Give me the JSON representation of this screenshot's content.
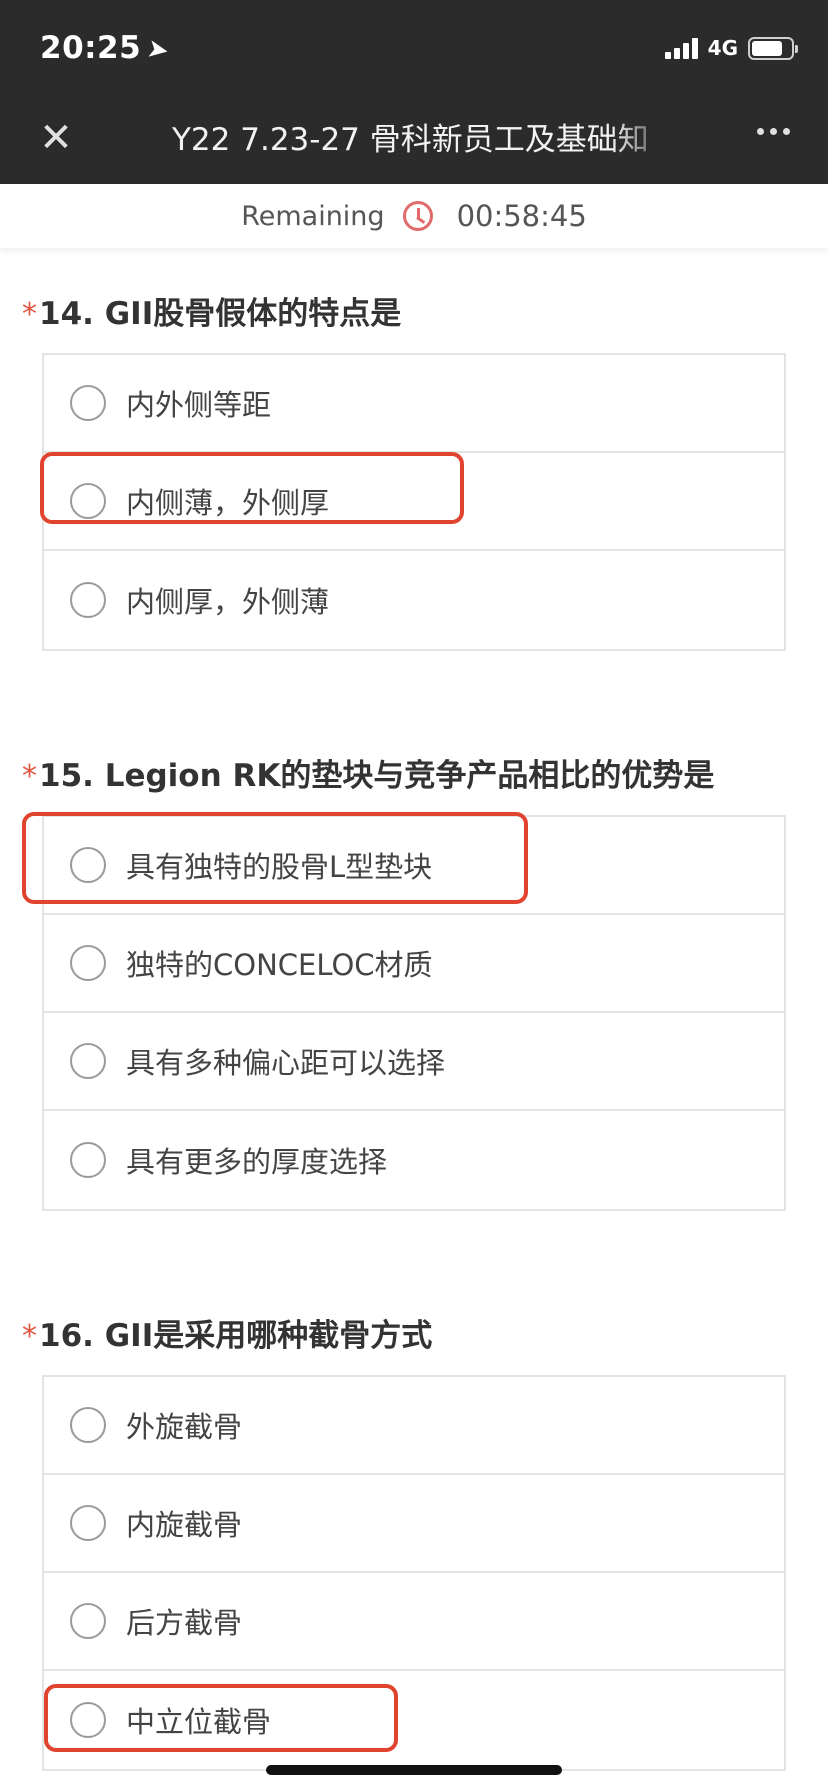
{
  "status_bar": {
    "time": "20:25",
    "network": "4G"
  },
  "nav": {
    "close_icon": "close-icon",
    "title": "Y22 7.23-27 骨科新员工及基础知",
    "more_icon": "more-icon"
  },
  "timer": {
    "label": "Remaining",
    "value": "00:58:45",
    "icon": "clock-icon",
    "icon_color": "#e06b6b"
  },
  "questions": [
    {
      "required_mark": "*",
      "title": "14. GII股骨假体的特点是",
      "options": [
        "内外侧等距",
        "内侧薄，外侧厚",
        "内侧厚，外侧薄"
      ],
      "highlighted_option": 1
    },
    {
      "required_mark": "*",
      "title": "15. Legion RK的垫块与竞争产品相比的优势是",
      "options": [
        "具有独特的股骨L型垫块",
        "独特的CONCELOC材质",
        "具有多种偏心距可以选择",
        "具有更多的厚度选择"
      ],
      "highlighted_option": 0
    },
    {
      "required_mark": "*",
      "title": "16.  GII是采用哪种截骨方式",
      "options": [
        "外旋截骨",
        "内旋截骨",
        "后方截骨",
        "中立位截骨"
      ],
      "highlighted_option": 3
    }
  ],
  "colors": {
    "header_bg": "#2b2b2b",
    "required_star": "#e0533f",
    "highlight_box": "#e0442f"
  }
}
